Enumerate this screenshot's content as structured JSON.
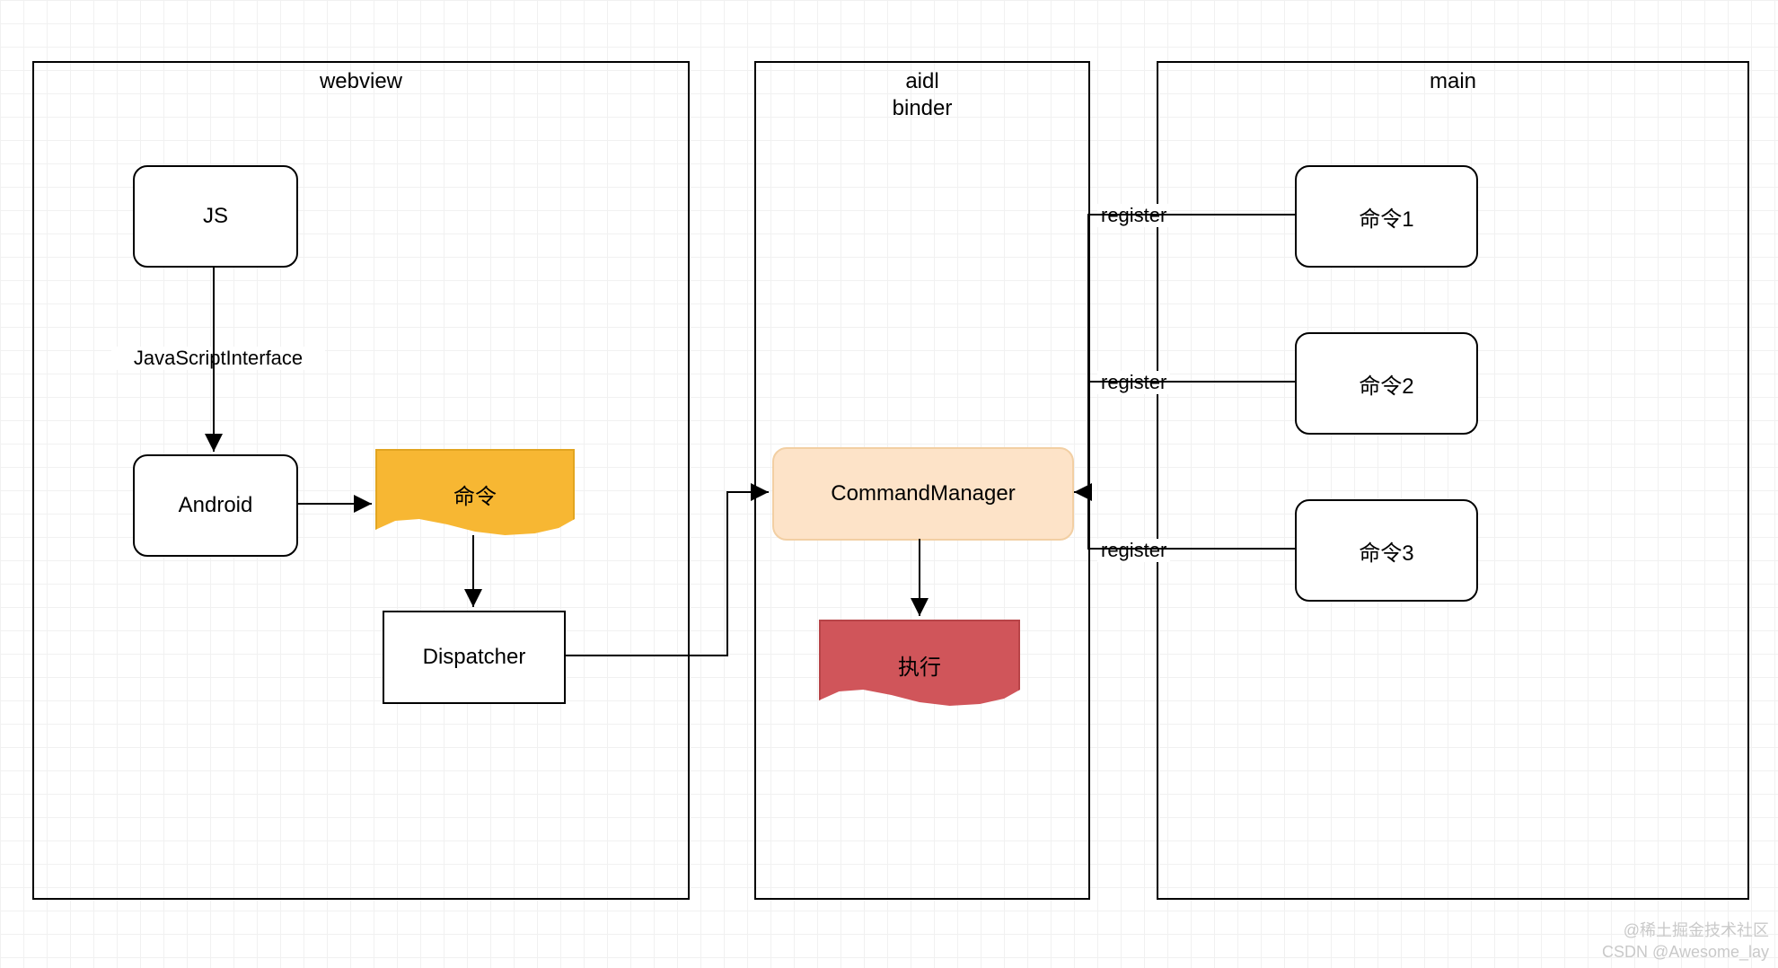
{
  "containers": {
    "webview": "webview",
    "aidl": "aidl\nbinder",
    "main": "main"
  },
  "nodes": {
    "js": "JS",
    "android": "Android",
    "dispatcher": "Dispatcher",
    "command": "命令",
    "commandManager": "CommandManager",
    "execute": "执行",
    "cmd1": "命令1",
    "cmd2": "命令2",
    "cmd3": "命令3"
  },
  "edges": {
    "jsi": "JavaScriptInterface",
    "register": "register"
  },
  "watermark": {
    "line1": "@稀土掘金技术社区",
    "line2": "CSDN @Awesome_lay"
  }
}
